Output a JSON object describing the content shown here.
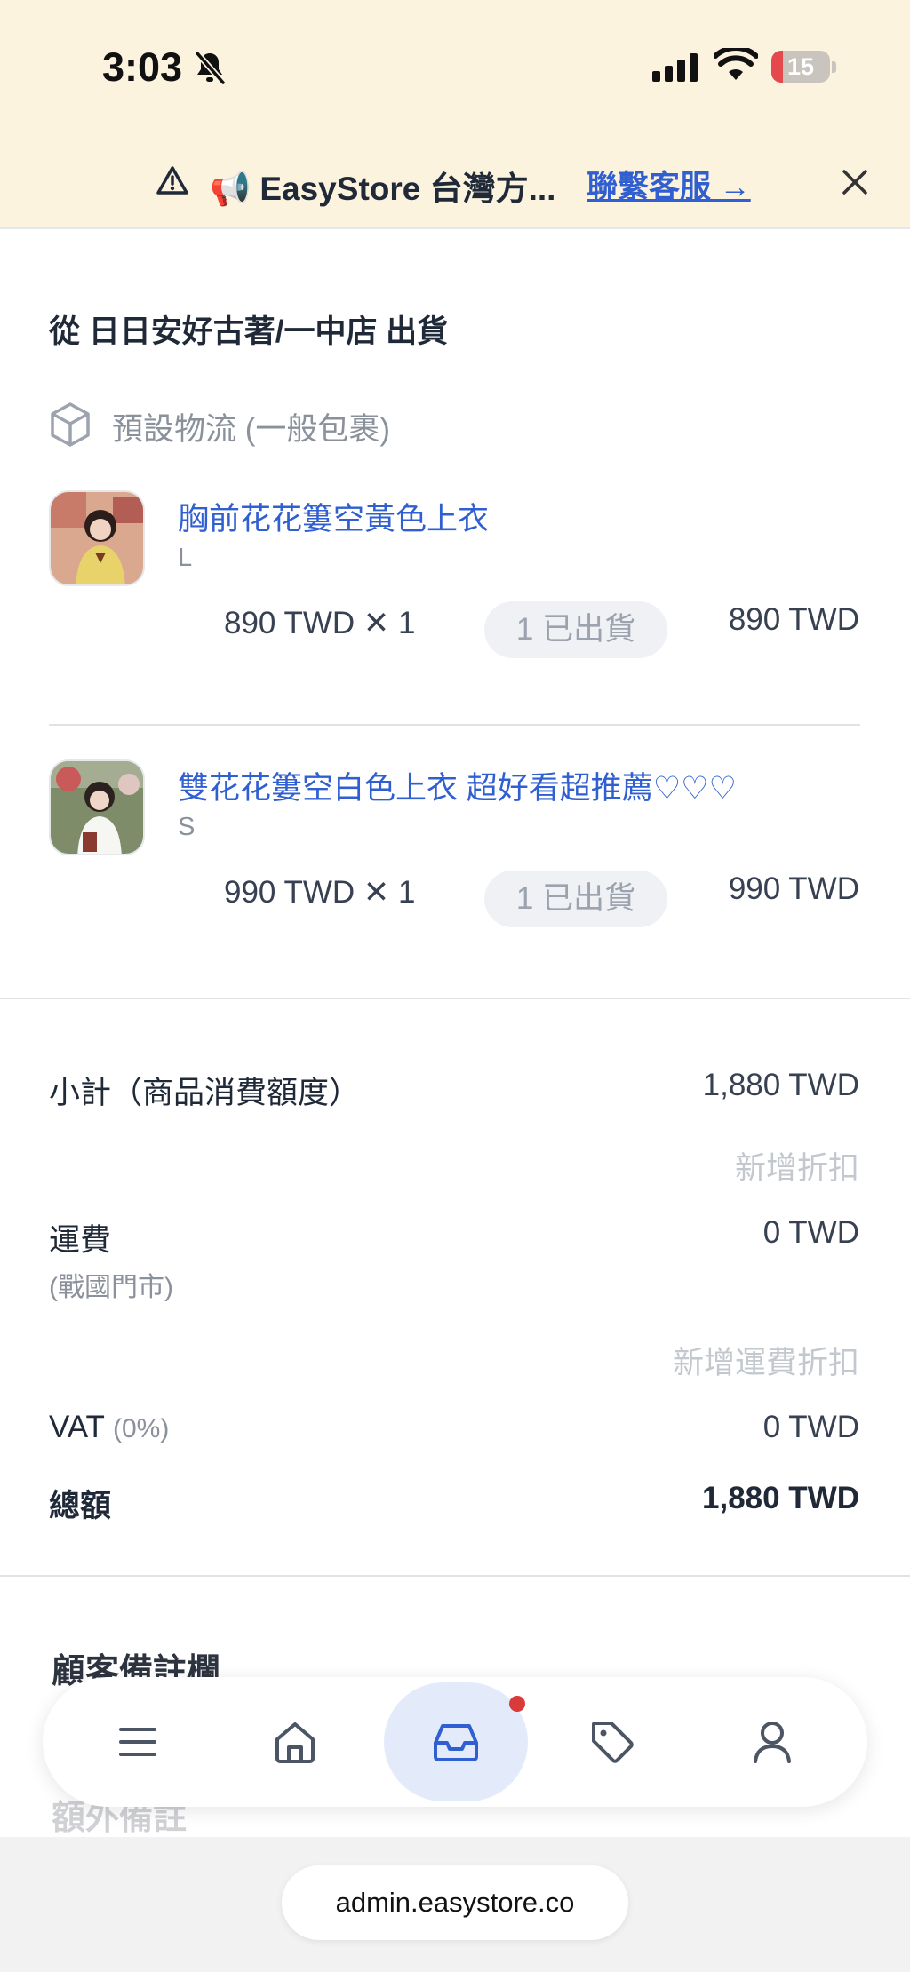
{
  "status_bar": {
    "time": "3:03",
    "battery": "15"
  },
  "banner": {
    "text": "📢 EasyStore 台灣方...",
    "link": "聯繫客服 →"
  },
  "shipment": {
    "title": "從 日日安好古著/一中店 出貨",
    "logistics": "預設物流 (一般包裹)",
    "items": [
      {
        "name": "胸前花花簍空黃色上衣",
        "variant": "L",
        "qty_text": "890 TWD  ✕  1",
        "status": "1 已出貨",
        "total": "890 TWD"
      },
      {
        "name": "雙花花簍空白色上衣 超好看超推薦♡♡♡",
        "variant": "S",
        "qty_text": "990 TWD  ✕  1",
        "status": "1 已出貨",
        "total": "990 TWD"
      }
    ]
  },
  "summary": {
    "subtotal_label": "小計（商品消費額度）",
    "subtotal_value": "1,880 TWD",
    "add_discount": "新增折扣",
    "shipping_label": "運費",
    "shipping_sub": "(戰國門市)",
    "shipping_value": "0 TWD",
    "add_shipping_discount": "新增運費折扣",
    "vat_label": "VAT",
    "vat_rate": "(0%)",
    "vat_value": "0 TWD",
    "total_label": "總額",
    "total_value": "1,880 TWD"
  },
  "sections": {
    "customer_notes": "顧客備註欄",
    "extra_notes": "額外備註"
  },
  "browser": {
    "url": "admin.easystore.co"
  },
  "colors": {
    "accent": "#2f5fd0",
    "banner_bg": "#fcf3df",
    "nav_active": "#e3ebfb",
    "badge": "#d93a3a"
  }
}
